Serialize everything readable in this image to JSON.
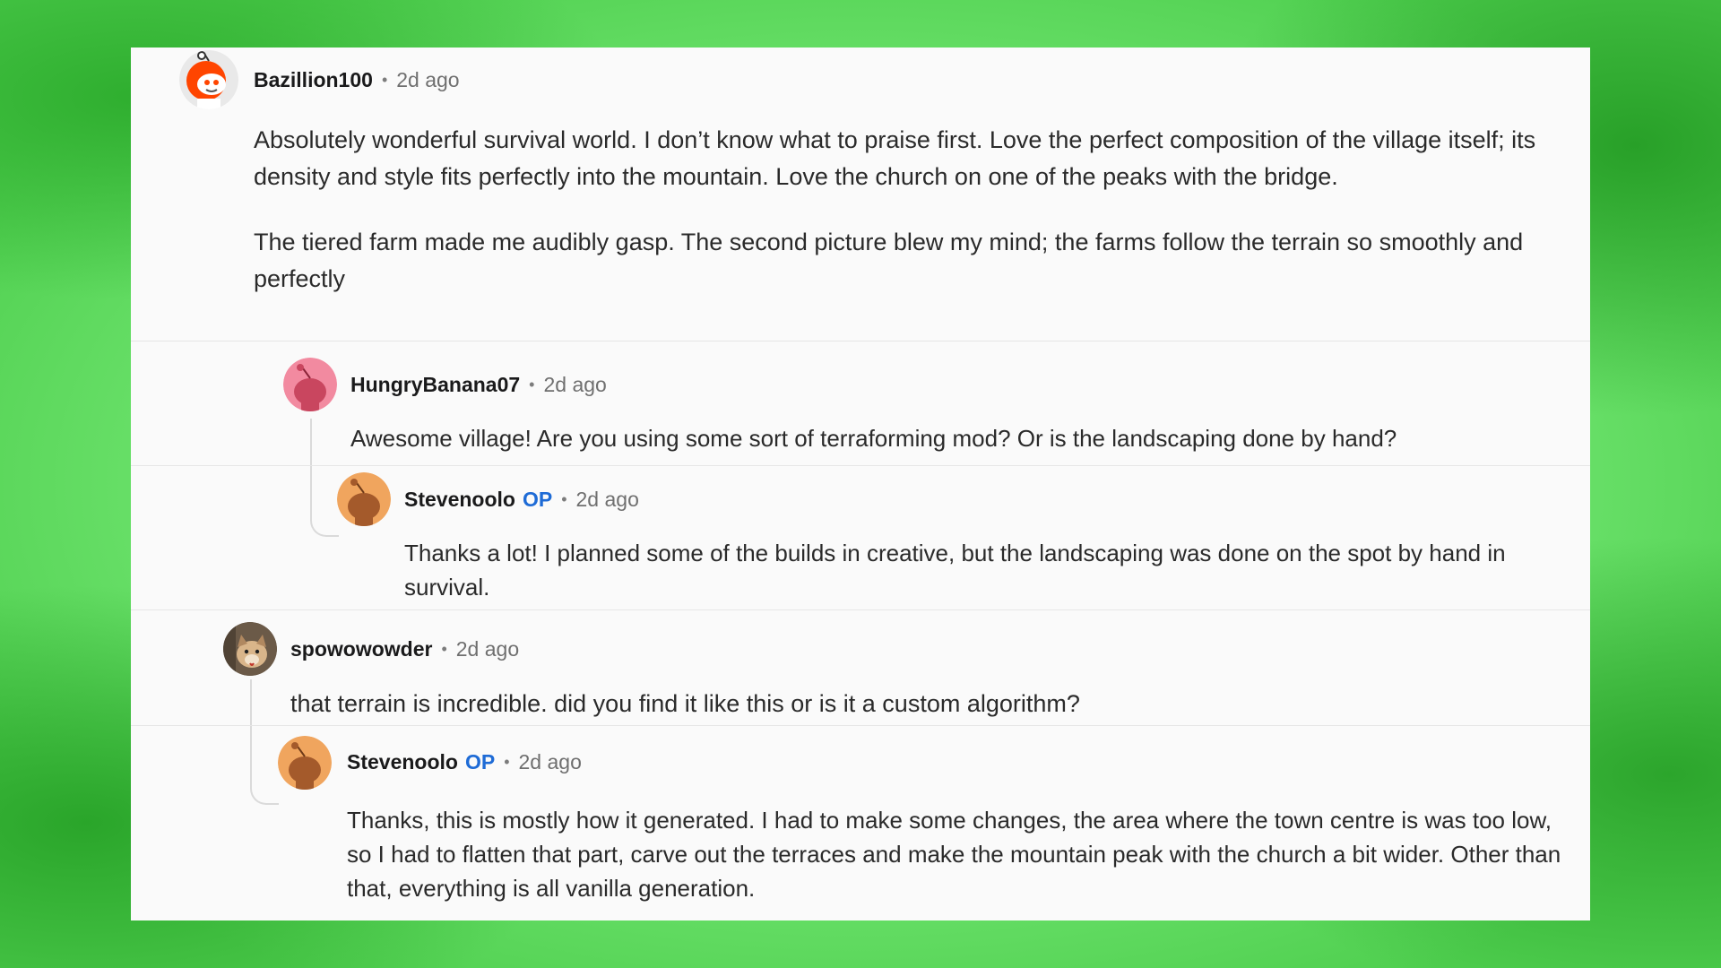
{
  "comments": [
    {
      "username": "Bazillion100",
      "op_badge": "",
      "time": "2d ago",
      "avatar": "reddit-snoo-orange-icon",
      "paragraphs": [
        "Absolutely wonderful survival world. I don’t know what to praise first. Love the perfect composition of the village itself; its density and style fits perfectly into the mountain. Love the church on one of the peaks with the bridge.",
        "The tiered farm made me audibly gasp. The second picture blew my mind; the farms follow the terrain so smoothly and perfectly"
      ]
    },
    {
      "username": "HungryBanana07",
      "op_badge": "",
      "time": "2d ago",
      "avatar": "reddit-snoo-pink-icon",
      "paragraphs": [
        "Awesome village! Are you using some sort of terraforming mod? Or is the landscaping done by hand?"
      ]
    },
    {
      "username": "Stevenoolo",
      "op_badge": "OP",
      "time": "2d ago",
      "avatar": "reddit-snoo-orange-icon",
      "paragraphs": [
        "Thanks a lot! I planned some of the builds in creative, but the landscaping was done on the spot by hand in survival."
      ]
    },
    {
      "username": "spowowowder",
      "op_badge": "",
      "time": "2d ago",
      "avatar": "cat-photo-avatar-icon",
      "paragraphs": [
        "that terrain is incredible. did you find it like this or is it a custom algorithm?"
      ]
    },
    {
      "username": "Stevenoolo",
      "op_badge": "OP",
      "time": "2d ago",
      "avatar": "reddit-snoo-orange-icon",
      "paragraphs": [
        "Thanks, this is mostly how it generated. I had to make some changes, the area where the town centre is was too low, so I had to flatten that part, carve out the terraces and make the mountain peak with the church a bit wider. Other than that, everything is all vanilla generation."
      ]
    }
  ],
  "separator": "•",
  "colors": {
    "background_green": "#6fe46f",
    "card": "#fafafa",
    "op_blue": "#1e6bd6",
    "snoo_orange": "#f0a55e",
    "snoo_red": "#ff4500",
    "snoo_pink": "#f28aa0"
  }
}
